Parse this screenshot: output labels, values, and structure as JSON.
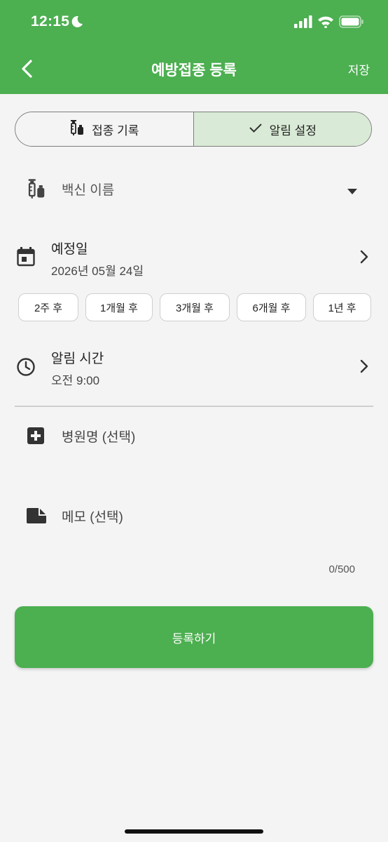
{
  "status_bar": {
    "time": "12:15"
  },
  "app_bar": {
    "title": "예방접종 등록",
    "save_label": "저장"
  },
  "tabs": [
    {
      "label": "접종 기록",
      "selected": false
    },
    {
      "label": "알림 설정",
      "selected": true
    }
  ],
  "vaccine": {
    "placeholder": "백신 이름"
  },
  "scheduled_date": {
    "title": "예정일",
    "value": "2026년 05월 24일"
  },
  "quick_chips": [
    "2주 후",
    "1개월 후",
    "3개월 후",
    "6개월 후",
    "1년 후"
  ],
  "alarm_time": {
    "title": "알림 시간",
    "value": "오전 9:00"
  },
  "hospital": {
    "placeholder": "병원명 (선택)"
  },
  "memo": {
    "placeholder": "메모 (선택)",
    "counter": "0/500"
  },
  "submit_label": "등록하기",
  "colors": {
    "primary": "#4caf50",
    "selected_tab_bg": "#d9ebd6",
    "background": "#f4f4f4"
  }
}
